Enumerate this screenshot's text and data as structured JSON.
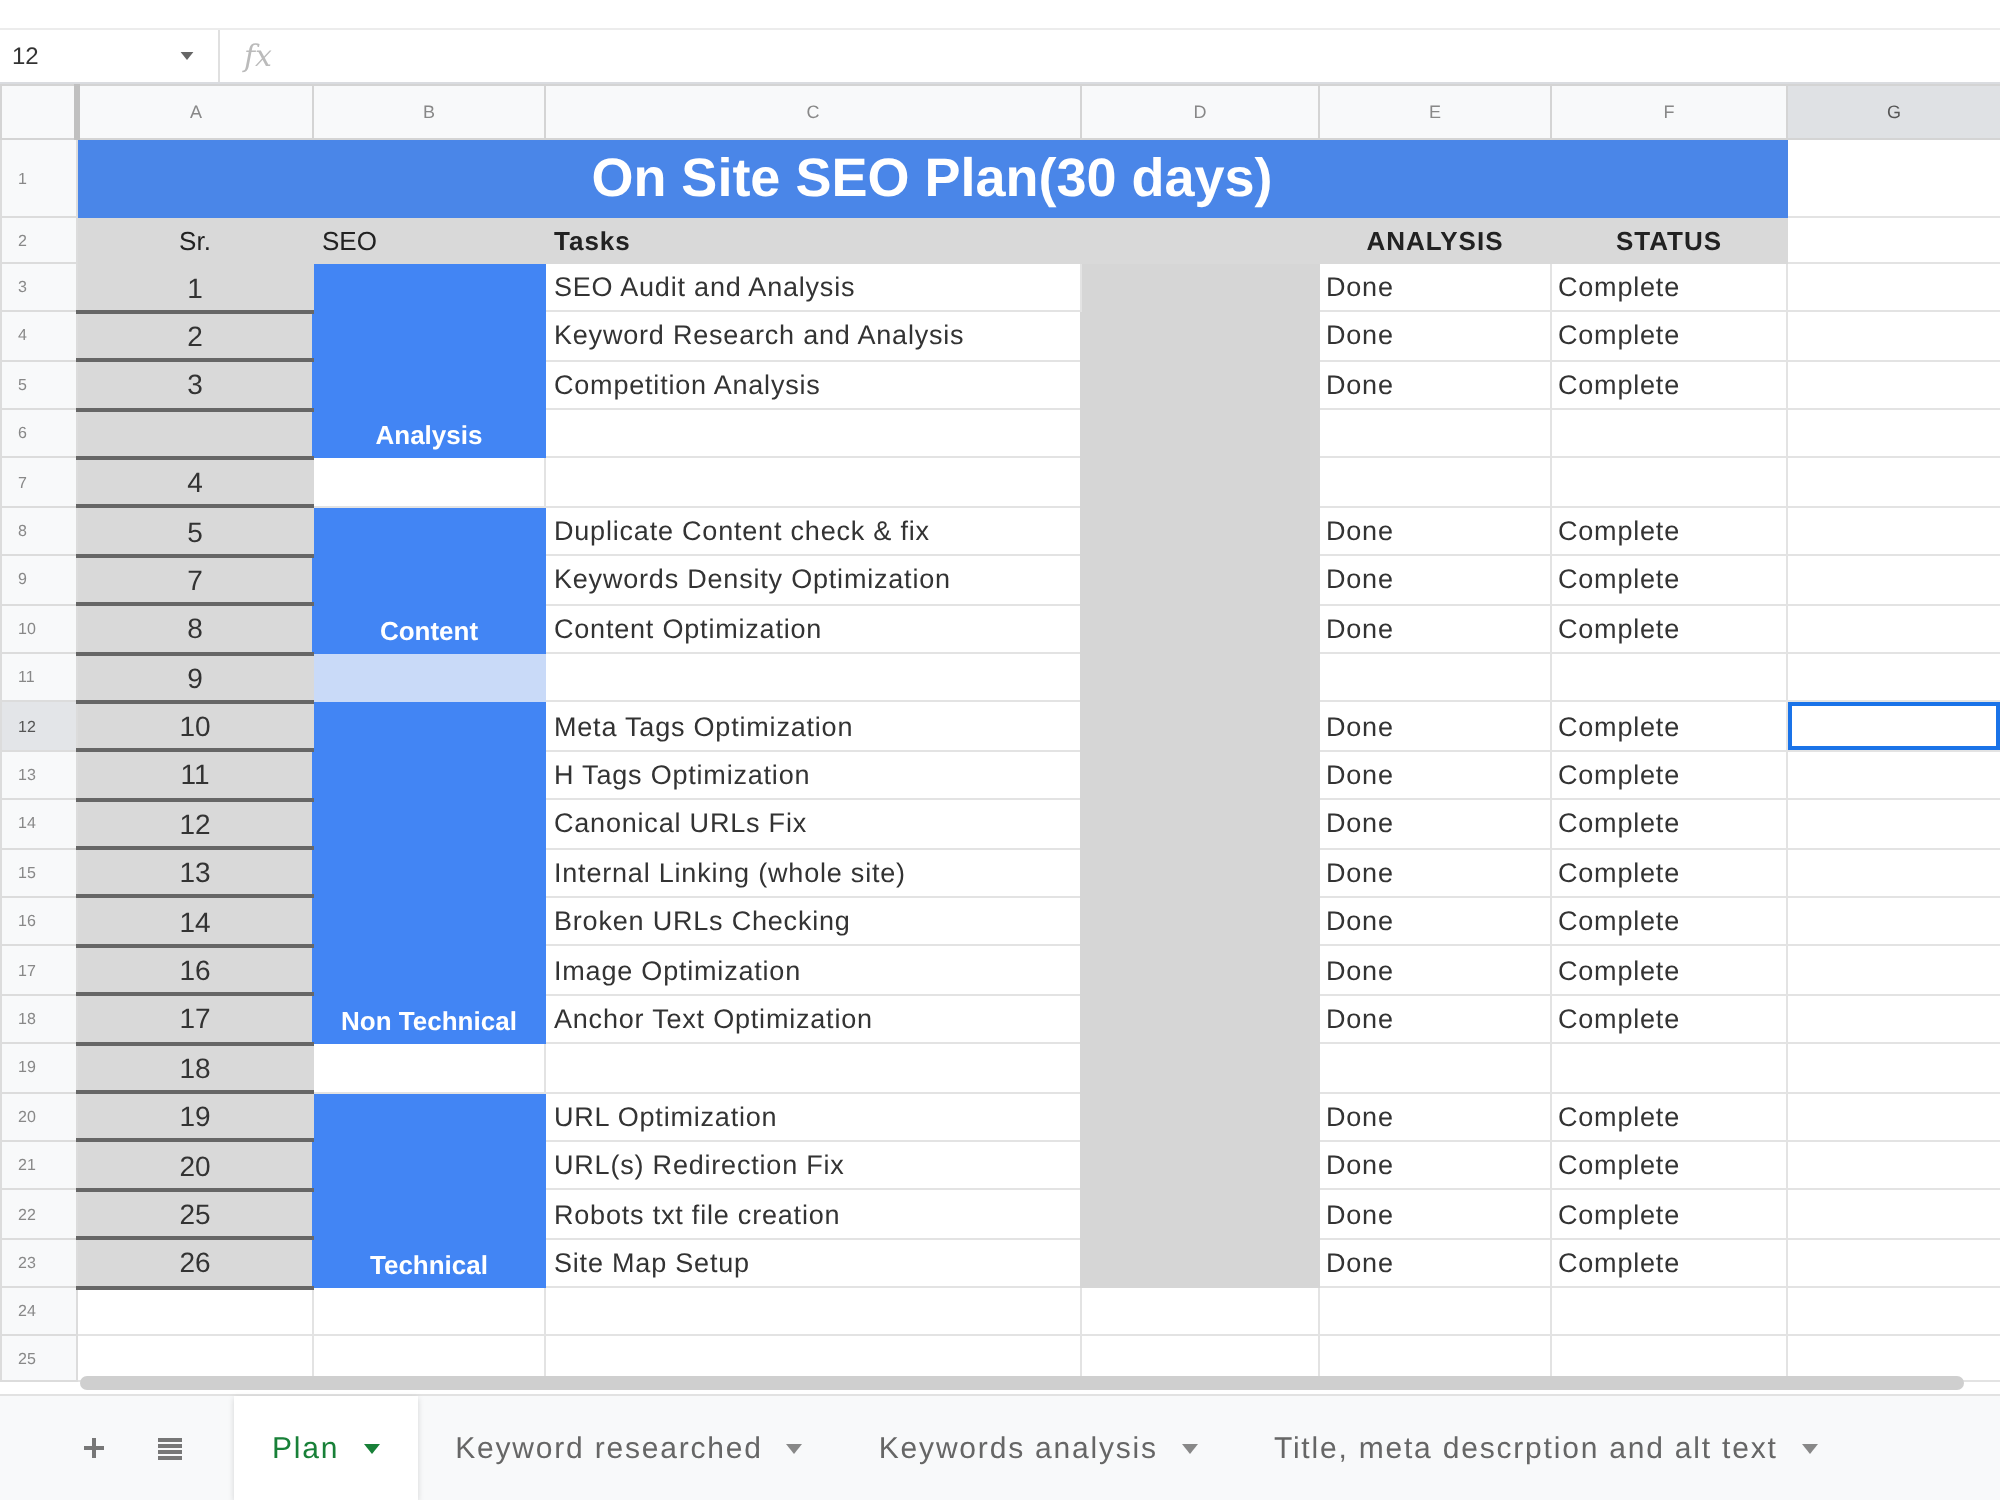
{
  "formula_bar": {
    "name_box": "12",
    "function_label": "fx"
  },
  "column_headers": [
    {
      "label": "A",
      "selected": false
    },
    {
      "label": "B",
      "selected": false
    },
    {
      "label": "C",
      "selected": false
    },
    {
      "label": "D",
      "selected": false
    },
    {
      "label": "E",
      "selected": false
    },
    {
      "label": "F",
      "selected": false
    },
    {
      "label": "G",
      "selected": true
    }
  ],
  "row_numbers": [
    {
      "label": "1",
      "selected": false
    },
    {
      "label": "2",
      "selected": false
    },
    {
      "label": "3",
      "selected": false
    },
    {
      "label": "4",
      "selected": false
    },
    {
      "label": "5",
      "selected": false
    },
    {
      "label": "6",
      "selected": false
    },
    {
      "label": "7",
      "selected": false
    },
    {
      "label": "8",
      "selected": false
    },
    {
      "label": "9",
      "selected": false
    },
    {
      "label": "10",
      "selected": false
    },
    {
      "label": "11",
      "selected": false
    },
    {
      "label": "12",
      "selected": true
    },
    {
      "label": "13",
      "selected": false
    },
    {
      "label": "14",
      "selected": false
    },
    {
      "label": "15",
      "selected": false
    },
    {
      "label": "16",
      "selected": false
    },
    {
      "label": "17",
      "selected": false
    },
    {
      "label": "18",
      "selected": false
    },
    {
      "label": "19",
      "selected": false
    },
    {
      "label": "20",
      "selected": false
    },
    {
      "label": "21",
      "selected": false
    },
    {
      "label": "22",
      "selected": false
    },
    {
      "label": "23",
      "selected": false
    },
    {
      "label": "24",
      "selected": false
    },
    {
      "label": "25",
      "selected": false
    }
  ],
  "title": "On Site SEO Plan(30 days)",
  "header": {
    "sr": "Sr.",
    "seo": "SEO",
    "tasks": "Tasks",
    "analysis": "ANALYSIS",
    "status": "STATUS"
  },
  "sections": [
    {
      "kind": "category",
      "label": "Analysis",
      "rows": [
        {
          "sr": "1",
          "task": "SEO Audit and Analysis",
          "analysis": "Done",
          "status": "Complete"
        },
        {
          "sr": "2",
          "task": "Keyword Research and Analysis",
          "analysis": "Done",
          "status": "Complete"
        },
        {
          "sr": "3",
          "task": "Competition Analysis",
          "analysis": "Done",
          "status": "Complete"
        },
        {}
      ]
    },
    {
      "kind": "gap",
      "rows": [
        {
          "sr": "4"
        }
      ]
    },
    {
      "kind": "category",
      "label": "Content",
      "rows": [
        {
          "sr": "5",
          "task": "Duplicate Content check & fix",
          "analysis": "Done",
          "status": "Complete"
        },
        {
          "sr": "7",
          "task": "Keywords Density Optimization",
          "analysis": "Done",
          "status": "Complete"
        },
        {
          "sr": "8",
          "task": "Content Optimization",
          "analysis": "Done",
          "status": "Complete"
        }
      ]
    },
    {
      "kind": "tint",
      "rows": [
        {
          "sr": "9"
        }
      ]
    },
    {
      "kind": "category",
      "label": "Non Technical",
      "rows": [
        {
          "sr": "10",
          "task": "Meta Tags Optimization",
          "analysis": "Done",
          "status": "Complete"
        },
        {
          "sr": "11",
          "task": "H Tags Optimization",
          "analysis": "Done",
          "status": "Complete"
        },
        {
          "sr": "12",
          "task": "Canonical URLs Fix",
          "analysis": "Done",
          "status": "Complete"
        },
        {
          "sr": "13",
          "task": "Internal Linking (whole site)",
          "analysis": "Done",
          "status": "Complete"
        },
        {
          "sr": "14",
          "task": "Broken URLs Checking",
          "analysis": "Done",
          "status": "Complete"
        },
        {
          "sr": "16",
          "task": "Image Optimization",
          "analysis": "Done",
          "status": "Complete"
        },
        {
          "sr": "17",
          "task": "Anchor Text Optimization",
          "analysis": "Done",
          "status": "Complete"
        }
      ]
    },
    {
      "kind": "gap",
      "rows": [
        {
          "sr": "18"
        }
      ]
    },
    {
      "kind": "category",
      "label": "Technical",
      "rows": [
        {
          "sr": "19",
          "task": "URL Optimization",
          "analysis": "Done",
          "status": "Complete"
        },
        {
          "sr": "20",
          "task": "URL(s) Redirection Fix",
          "analysis": "Done",
          "status": "Complete"
        },
        {
          "sr": "25",
          "task": "Robots txt file creation",
          "analysis": "Done",
          "status": "Complete"
        },
        {
          "sr": "26",
          "task": "Site Map Setup",
          "analysis": "Done",
          "status": "Complete"
        }
      ]
    }
  ],
  "sheet_tabs": [
    {
      "label": "Plan",
      "selected": true
    },
    {
      "label": "Keyword researched",
      "selected": false
    },
    {
      "label": "Keywords analysis",
      "selected": false
    },
    {
      "label": "Title, meta descrption and alt text",
      "selected": false
    }
  ]
}
